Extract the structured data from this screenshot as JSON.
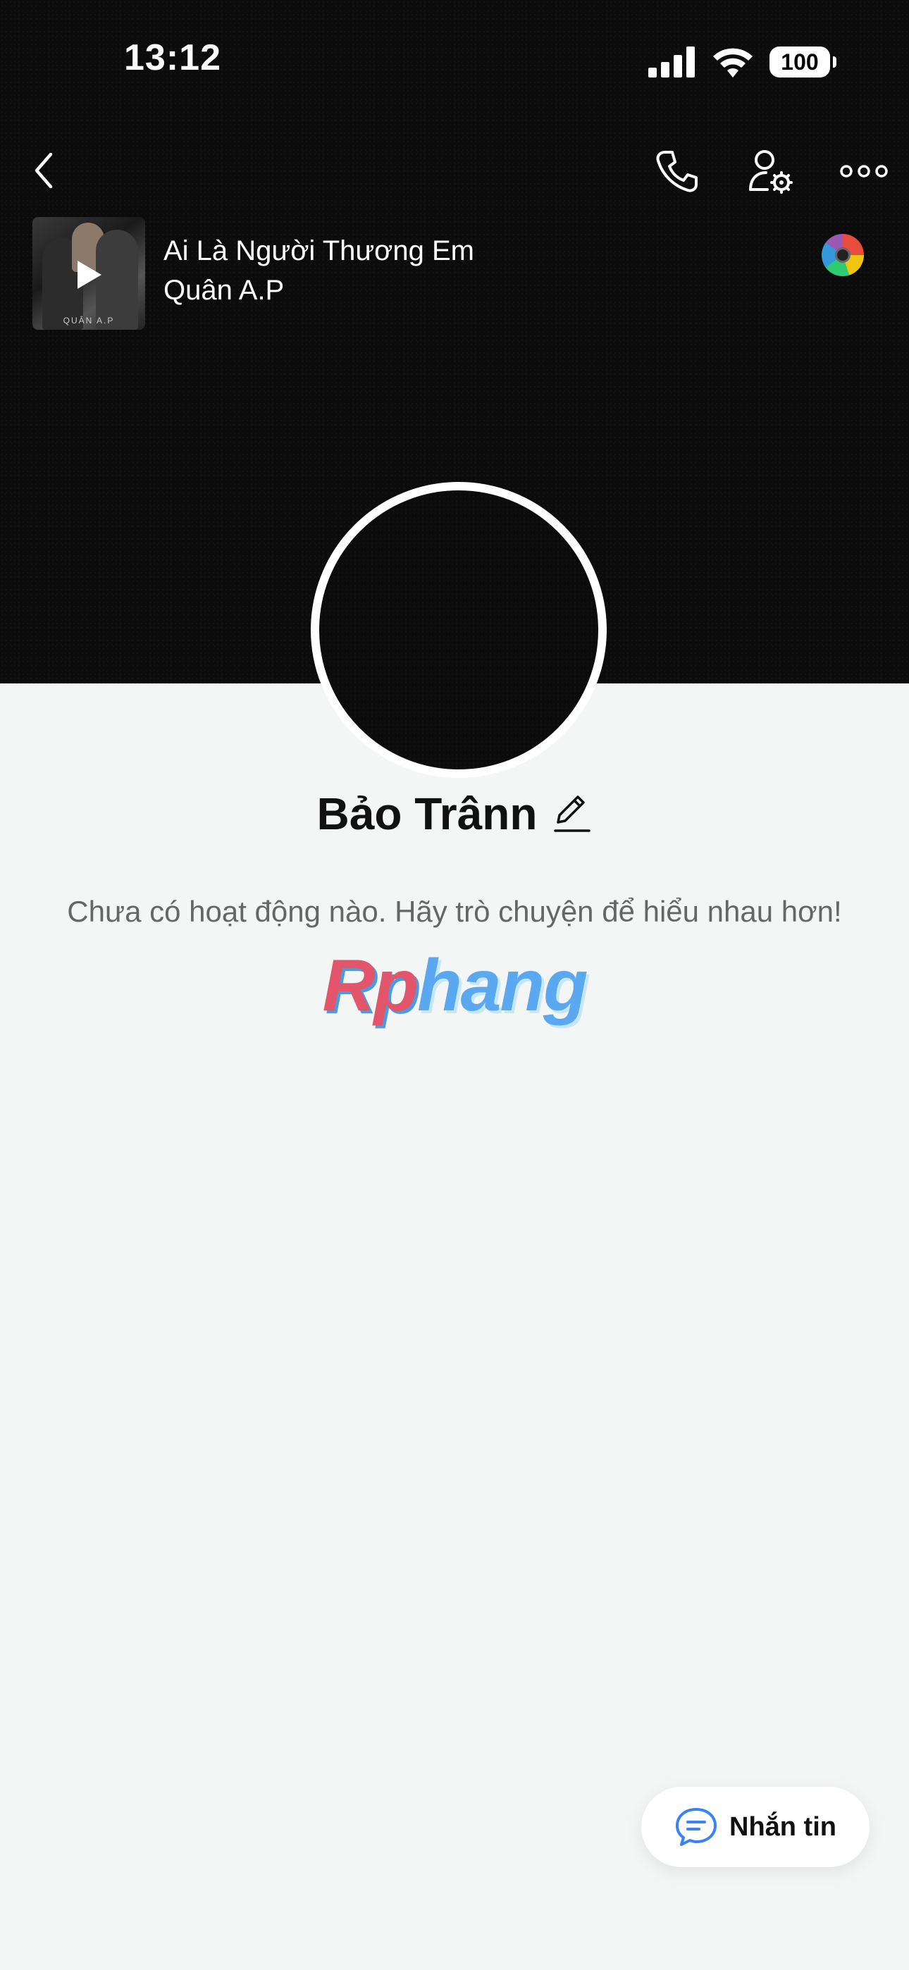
{
  "status_bar": {
    "time": "13:12",
    "battery": "100"
  },
  "music": {
    "title": "Ai Là Người Thương Em",
    "artist": "Quân A.P",
    "album_caption": "QUÂN A.P"
  },
  "profile": {
    "name": "Bảo Trânn",
    "empty_message": "Chưa có hoạt động nào. Hãy trò chuyện để hiểu nhau hơn!"
  },
  "watermark": {
    "part1": "Rp",
    "part2": "hang"
  },
  "actions": {
    "message_label": "Nhắn tin"
  },
  "colors": {
    "accent": "#3b82f6",
    "cover_bg": "#0b0b0b",
    "page_bg": "#f4f5f5"
  },
  "icons": [
    "back-icon",
    "phone-icon",
    "user-settings-icon",
    "more-icon",
    "play-icon",
    "disc-icon",
    "pencil-icon",
    "chat-icon"
  ]
}
